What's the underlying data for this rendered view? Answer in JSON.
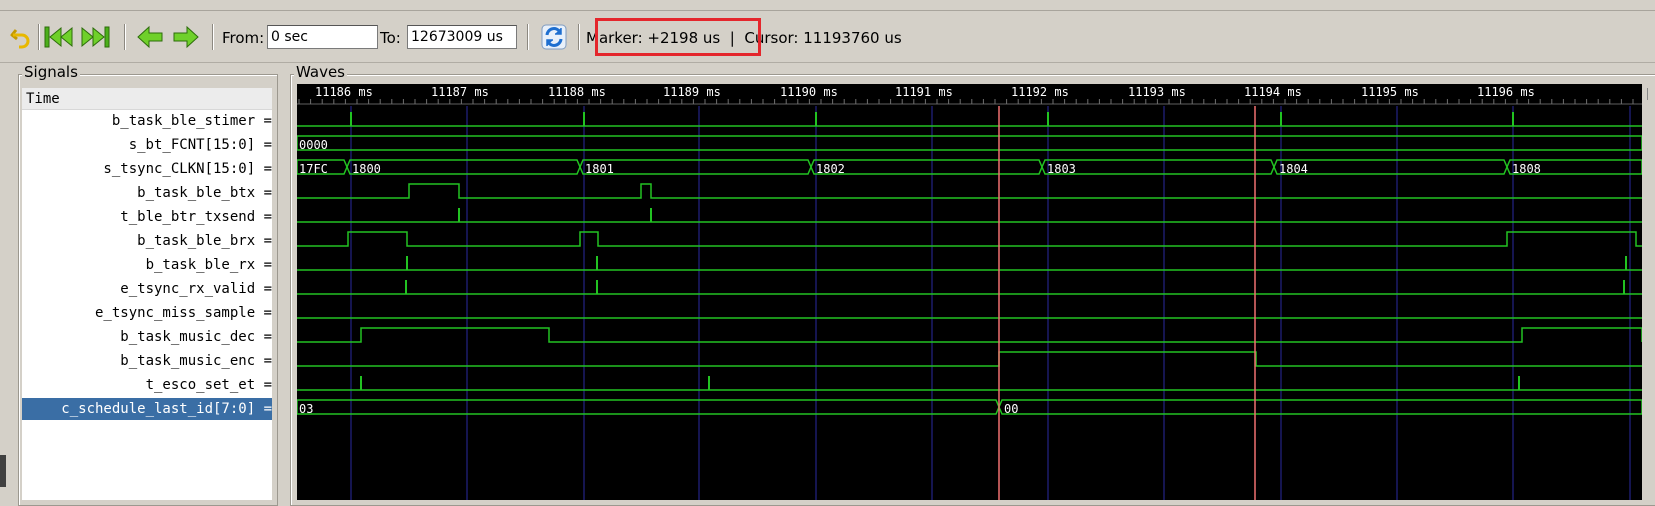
{
  "toolbar": {
    "from_label": "From:",
    "from_value": "0 sec",
    "to_label": "To:",
    "to_value": "12673009 us",
    "marker_text": "Marker: +2198 us  |  Cursor: 11193760 us",
    "icons": [
      "undo-icon",
      "zoom-to-start-icon",
      "zoom-to-end-icon",
      "shift-left-icon",
      "shift-right-icon",
      "reload-icon"
    ]
  },
  "signals": {
    "title": "Signals",
    "time_label": "Time",
    "items": [
      {
        "name": "b_task_ble_stimer ="
      },
      {
        "name": "s_bt_FCNT[15:0] ="
      },
      {
        "name": "s_tsync_CLKN[15:0] ="
      },
      {
        "name": "b_task_ble_btx ="
      },
      {
        "name": "t_ble_btr_txsend ="
      },
      {
        "name": "b_task_ble_brx ="
      },
      {
        "name": "b_task_ble_rx ="
      },
      {
        "name": "e_tsync_rx_valid ="
      },
      {
        "name": "e_tsync_miss_sample ="
      },
      {
        "name": "b_task_music_dec ="
      },
      {
        "name": "b_task_music_enc ="
      },
      {
        "name": "t_esco_set_et ="
      },
      {
        "name": "c_schedule_last_id[7:0] ="
      }
    ],
    "selected_index": 12
  },
  "waves": {
    "title": "Waves",
    "time_ticks": [
      "11186 ms",
      "11187 ms",
      "11188 ms",
      "11189 ms",
      "11190 ms",
      "11191 ms",
      "11192 ms",
      "11193 ms",
      "11194 ms",
      "11195 ms",
      "11196 ms"
    ],
    "bus_values": {
      "s_bt_FCNT": [
        "0000"
      ],
      "s_tsync_CLKN": [
        "17FC",
        "1800",
        "1801",
        "1802",
        "1803",
        "1804",
        "1808"
      ],
      "c_schedule_last_id": [
        "03",
        "00"
      ]
    },
    "colors": {
      "background": "#000000",
      "trace": "#22c322",
      "grid": "#2a2aa0",
      "marker": "#f07070",
      "text": "#ffffff"
    }
  }
}
